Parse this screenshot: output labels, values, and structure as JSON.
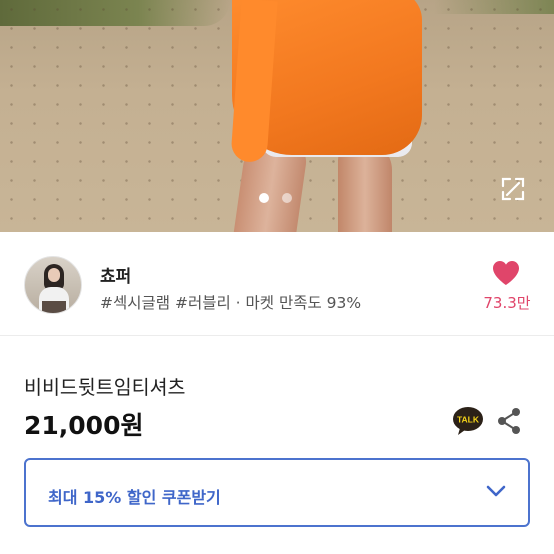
{
  "product_image": {
    "icon": "expand-icon",
    "slide_count": 2,
    "active_slide": 1
  },
  "seller": {
    "name": "쵸퍼",
    "tags": "#섹시글램 #러블리 · 마켓 만족도 93%",
    "likes": "73.3만",
    "heart_color": "#e0456a"
  },
  "product": {
    "name": "비비드뒷트임티셔츠",
    "price": "21,000원"
  },
  "actions": {
    "talk_label": "TALK",
    "share_icon": "share-icon"
  },
  "coupon": {
    "label": "최대 15% 할인 쿠폰받기",
    "accent": "#3f66c9"
  }
}
